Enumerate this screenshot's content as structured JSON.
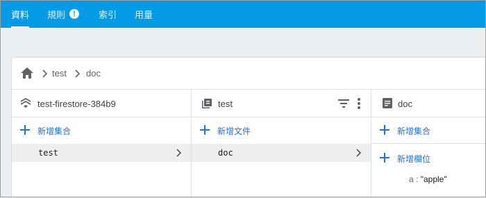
{
  "tabs": [
    {
      "label": "資料",
      "active": true
    },
    {
      "label": "規則",
      "warning_icon": "alert-circle-icon"
    },
    {
      "label": "索引"
    },
    {
      "label": "用量"
    }
  ],
  "warning_glyph": "!",
  "breadcrumb": {
    "home_icon": "home-icon",
    "items": [
      "test",
      "doc"
    ]
  },
  "columns": {
    "project": {
      "icon": "firestore-icon",
      "title": "test-firestore-384b9",
      "add_label": "新增集合",
      "items": [
        {
          "label": "test",
          "selected": true
        }
      ]
    },
    "collection": {
      "icon": "collection-icon",
      "title": "test",
      "add_label": "新增文件",
      "items": [
        {
          "label": "doc",
          "selected": true
        }
      ],
      "filter_icon": "filter-icon",
      "more_icon": "more-vert-icon"
    },
    "document": {
      "icon": "document-icon",
      "title": "doc",
      "add_collection_label": "新增集合",
      "add_field_label": "新增欄位",
      "fields": [
        {
          "key": "a",
          "separator": ":",
          "value": "\"apple\""
        }
      ]
    }
  },
  "colors": {
    "tabbar": "#039be5",
    "accent": "#1a73e8",
    "selected_row": "#eeeeee",
    "background": "#eceff1"
  }
}
